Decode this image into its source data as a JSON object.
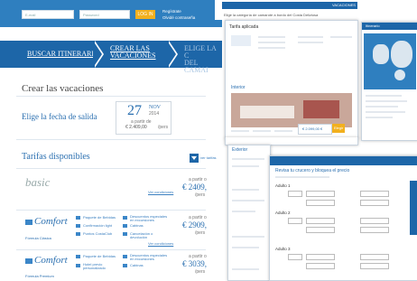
{
  "header": {
    "input1_placeholder": "E-mail",
    "input2_placeholder": "Password",
    "login_label": "LOG IN",
    "register_link": "Regístrate",
    "forgot_link": "Olvidé contraseña"
  },
  "steps": [
    {
      "label_line1": "BUSCAR ITINERARIO",
      "label_line2": ""
    },
    {
      "label_line1": "CREAR LAS",
      "label_line2": "VACACIONES"
    },
    {
      "label_line1": "ELIGE LA C",
      "label_line2": "DEL CAMAI"
    }
  ],
  "main": {
    "title": "Crear las vacaciones",
    "date_prompt": "Elige la fecha de salida",
    "date": {
      "day": "27",
      "month": "NOV",
      "year": "2014",
      "from_text": "a partir de",
      "price": "€ 2.409,00",
      "per_person": "/pers"
    },
    "fares_title": "Tarifas disponibles",
    "fares_button": "ver tarifas"
  },
  "fares": [
    {
      "name": "basic",
      "sub": "",
      "link": "Ver condiciones",
      "from": "a partir o",
      "price": "€ 2409,",
      "per": "/pers",
      "features": []
    },
    {
      "name": "Comfort",
      "sub": "Fórmula Clásica",
      "link": "Ver condiciones",
      "from": "a partir o",
      "price": "€ 2909,",
      "per": "/pers",
      "features": [
        "Paquete de Bebidas",
        "Descuentos especiales en excursiones",
        "Confirmación light",
        "Cabinas",
        "Puntos CostaClub",
        "Cancelación o devolución"
      ]
    },
    {
      "name": "Comfort",
      "sub": "Fórmula Premium",
      "link": "Ver condiciones",
      "from": "a partir o",
      "price": "€ 3039,",
      "per": "/pers",
      "features": [
        "Paquete de Bebidas",
        "Descuentos especiales en excursiones",
        "Hotel previo personalizado",
        "Cabinas"
      ]
    }
  ],
  "collage": {
    "top_tabs": [
      "VACACIONES"
    ],
    "cabin_prompt": "Elige la categoría de camarote a bordo del Costa Deliziosa",
    "tariff_title": "Tarifa aplicada",
    "interior_label": "Interior",
    "exterior_label": "Exterior",
    "price_tag": "€ 2.099,00 €",
    "select_btn": "Elegir",
    "form_title": "Revisa tu crucero y bloquea el precio",
    "adult1": "Adulto 1",
    "adult2": "Adulto 2",
    "adult3": "Adulto 3",
    "side_heading": "Itinerario"
  },
  "colors": {
    "header_blue": "#2f7fbf",
    "step_blue": "#1d66a8",
    "accent_yellow": "#f2b01e",
    "link_blue": "#2a6fb0"
  }
}
